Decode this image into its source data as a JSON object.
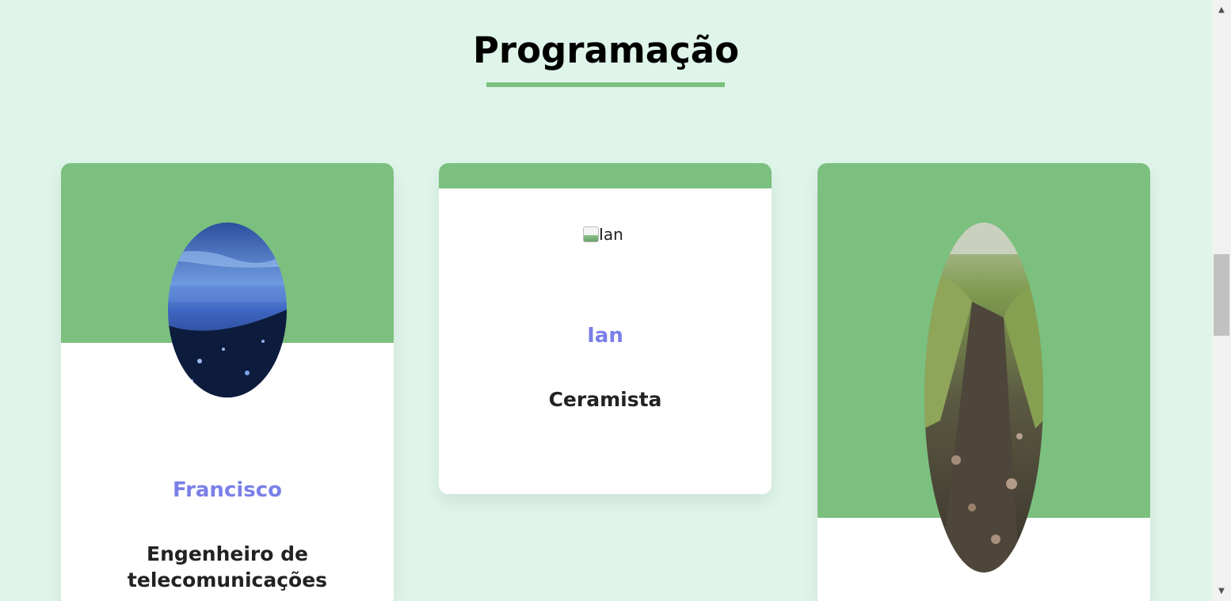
{
  "section": {
    "title": "Programação"
  },
  "cards": [
    {
      "name": "Francisco",
      "role": "Engenheiro de telecomunicações",
      "image": "ocean-shore-photo"
    },
    {
      "name": "Ian",
      "role": "Ceramista",
      "image_alt": "Ian"
    },
    {
      "image": "forest-path-photo"
    }
  ],
  "colors": {
    "background": "#dff5ea",
    "accent_green": "#7cc07f",
    "name_color": "#7a7fe8",
    "card_bg": "#ffffff"
  },
  "icons": {
    "scroll_up": "scroll-up-arrow-icon",
    "scroll_down": "scroll-down-arrow-icon",
    "broken_image": "broken-image-icon"
  }
}
